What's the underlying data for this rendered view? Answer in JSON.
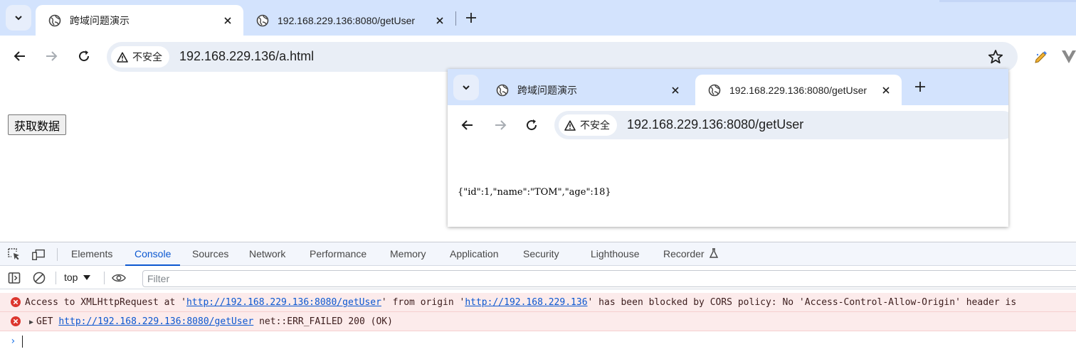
{
  "main_window": {
    "tabs": [
      {
        "title": "跨域问题演示",
        "active": true
      },
      {
        "title": "192.168.229.136:8080/getUser",
        "active": false
      }
    ],
    "security_label": "不安全",
    "url": "192.168.229.136/a.html"
  },
  "page": {
    "button_label": "获取数据"
  },
  "popup_window": {
    "tabs": [
      {
        "title": "跨域问题演示",
        "active": false
      },
      {
        "title": "192.168.229.136:8080/getUser",
        "active": true
      }
    ],
    "security_label": "不安全",
    "url": "192.168.229.136:8080/getUser",
    "body_text": "{\"id\":1,\"name\":\"TOM\",\"age\":18}"
  },
  "devtools": {
    "tabs": [
      "Elements",
      "Console",
      "Sources",
      "Network",
      "Performance",
      "Memory",
      "Application",
      "Security",
      "Lighthouse",
      "Recorder"
    ],
    "active_tab": "Console",
    "context": "top",
    "filter_placeholder": "Filter",
    "messages": [
      {
        "level": "error",
        "part1": "Access to XMLHttpRequest at '",
        "link1": "http://192.168.229.136:8080/getUser",
        "part2": "' from origin '",
        "link2": "http://192.168.229.136",
        "part3": "' has been blocked by CORS policy: No 'Access-Control-Allow-Origin' header is"
      },
      {
        "level": "error",
        "prefix": "GET ",
        "link": "http://192.168.229.136:8080/getUser",
        "suffix": " net::ERR_FAILED 200 (OK)"
      }
    ],
    "prompt_symbol": "›"
  },
  "colors": {
    "tabstrip": "#d3e3fd",
    "accent": "#0b57d0",
    "error_bg": "#fcebeb",
    "error_icon": "#dc362e"
  }
}
